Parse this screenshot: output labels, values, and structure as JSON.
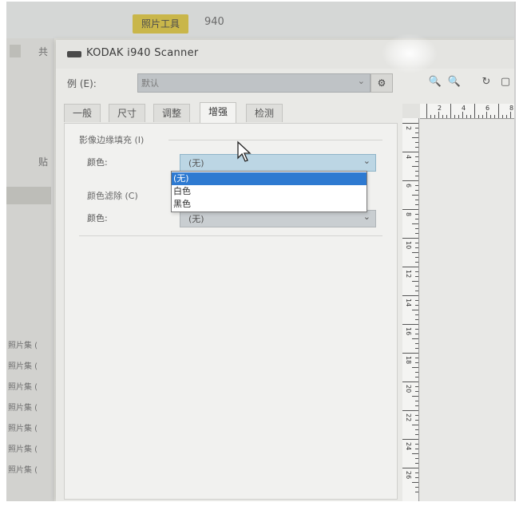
{
  "background_app": {
    "tab_tag": "照片工具",
    "title": "940",
    "left_items": [
      "共",
      "贴",
      "照片集 (",
      "照片集 (",
      "照片集 (",
      "照片集 (",
      "照片集 (",
      "照片集 (",
      "照片集 ("
    ]
  },
  "window": {
    "title": "KODAK i940 Scanner",
    "profile_label": "例 (E):",
    "profile_value": "默认",
    "toolbar_icons": [
      "gear-icon",
      "zoom-in-icon",
      "zoom-out-icon",
      "rotate-icon",
      "fit-icon"
    ]
  },
  "tabs": [
    {
      "label": "一般",
      "active": false
    },
    {
      "label": "尺寸",
      "active": false
    },
    {
      "label": "调整",
      "active": false
    },
    {
      "label": "增强",
      "active": true
    },
    {
      "label": "检测",
      "active": false
    }
  ],
  "enhance": {
    "edge_fill": {
      "group_label": "影像边缘填充 (I)",
      "color_label": "颜色:",
      "value": "(无)",
      "dropdown_open": true,
      "options": [
        "(无)",
        "白色",
        "黑色"
      ],
      "selected_index": 0
    },
    "color_drop": {
      "group_label": "颜色滤除 (C)",
      "color_label": "颜色:",
      "value": "(无)"
    }
  },
  "preview": {
    "ruler_top": [
      "2",
      "4",
      "6",
      "8"
    ],
    "ruler_left": [
      "2",
      "4",
      "6",
      "8",
      "10",
      "12",
      "14",
      "16",
      "18",
      "20",
      "22",
      "24",
      "26"
    ]
  },
  "colors": {
    "selection": "#2e7ad1",
    "combo_active": "#bcd6e4",
    "tag": "#c9b64a"
  }
}
